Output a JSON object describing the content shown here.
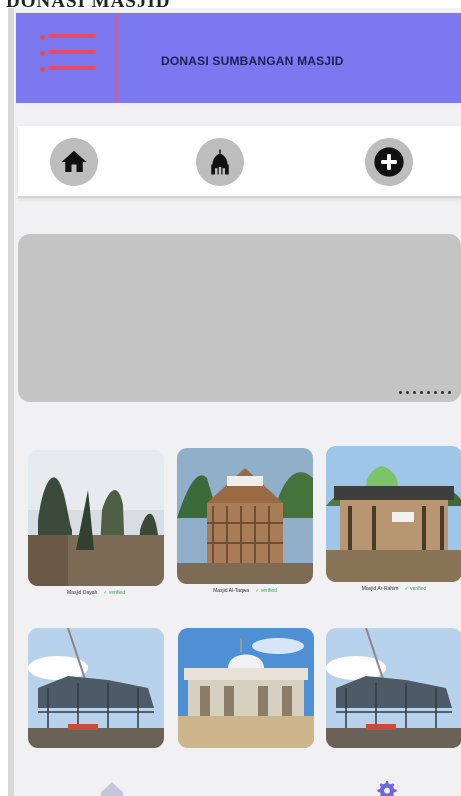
{
  "page_label": "DONASI MASJID",
  "header": {
    "title": "DONASI SUMBANGAN MASJID",
    "menu_icon": "hamburger-menu-icon",
    "color": "#7b78f0",
    "accent": "#e54a64"
  },
  "nav": [
    {
      "icon": "home-icon"
    },
    {
      "icon": "mosque-icon"
    },
    {
      "icon": "plus-circle-icon"
    }
  ],
  "banner": {
    "slide_count": 8
  },
  "mosques": [
    {
      "name": "Masjid Dayah",
      "status": "✓ verified"
    },
    {
      "name": "Masjid Al-Taqwa",
      "status": "✓ verified"
    },
    {
      "name": "Masjid Ar-Rahim",
      "status": "✓ verified"
    },
    {
      "name": "",
      "status": ""
    },
    {
      "name": "",
      "status": ""
    },
    {
      "name": "",
      "status": ""
    }
  ],
  "bottom_nav": [
    {
      "icon": "home-icon"
    },
    {
      "icon": "settings-gear-icon"
    }
  ]
}
